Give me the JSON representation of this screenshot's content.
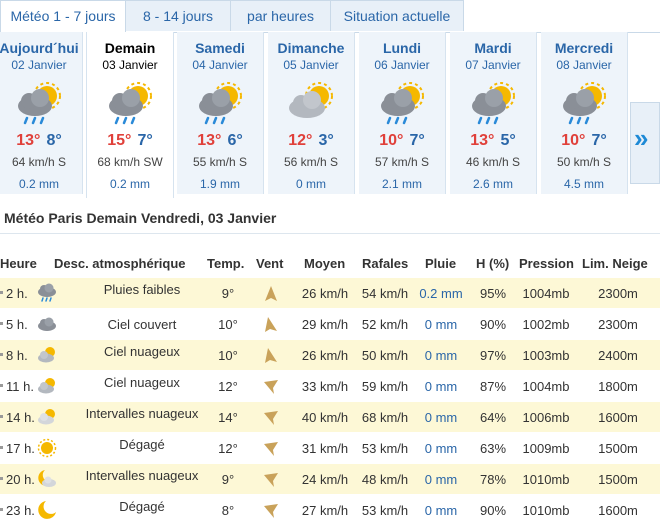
{
  "tabs": [
    {
      "label": "Météo 1 - 7 jours",
      "active": true
    },
    {
      "label": "8 - 14 jours",
      "active": false
    },
    {
      "label": "par heures",
      "active": false
    },
    {
      "label": "Situation actuelle",
      "active": false
    }
  ],
  "days": [
    {
      "name": "Aujourd´hui",
      "date": "02 Janvier",
      "tmax": "13°",
      "tmin": "8°",
      "wind": "64 km/h S",
      "rain": "0.2 mm",
      "icon": "cloud-sun-rain-icon",
      "active": false
    },
    {
      "name": "Demain",
      "date": "03 Janvier",
      "tmax": "15°",
      "tmin": "7°",
      "wind": "68 km/h SW",
      "rain": "0.2 mm",
      "icon": "cloud-sun-rain-icon",
      "active": true
    },
    {
      "name": "Samedi",
      "date": "04 Janvier",
      "tmax": "13°",
      "tmin": "6°",
      "wind": "55 km/h S",
      "rain": "1.9 mm",
      "icon": "cloud-sun-rain-icon",
      "active": false
    },
    {
      "name": "Dimanche",
      "date": "05 Janvier",
      "tmax": "12°",
      "tmin": "3°",
      "wind": "56 km/h S",
      "rain": "0 mm",
      "icon": "cloud-sun-icon",
      "active": false
    },
    {
      "name": "Lundi",
      "date": "06 Janvier",
      "tmax": "10°",
      "tmin": "7°",
      "wind": "57 km/h S",
      "rain": "2.1 mm",
      "icon": "cloud-sun-rain-icon",
      "active": false
    },
    {
      "name": "Mardi",
      "date": "07 Janvier",
      "tmax": "13°",
      "tmin": "5°",
      "wind": "46 km/h S",
      "rain": "2.6 mm",
      "icon": "cloud-sun-rain-icon",
      "active": false
    },
    {
      "name": "Mercredi",
      "date": "08 Janvier",
      "tmax": "10°",
      "tmin": "7°",
      "wind": "50 km/h S",
      "rain": "4.5 mm",
      "icon": "cloud-sun-rain-icon",
      "active": false
    }
  ],
  "next_arrow": "»",
  "title": "Météo Paris Demain Vendredi, 03 Janvier",
  "table": {
    "headers": {
      "hour": "Heure",
      "desc": "Desc. atmosphérique",
      "temp": "Temp.",
      "wind": "Vent",
      "avg": "Moyen",
      "gust": "Rafales",
      "rain": "Pluie",
      "hum": "H (%)",
      "press": "Pression",
      "snow": "Lim. Neige"
    },
    "rows": [
      {
        "hour": "2 h.",
        "icon": "cloud-rain-icon",
        "desc": "Pluies faibles",
        "temp": "9°",
        "avg": "26 km/h",
        "gust": "54 km/h",
        "rain": "0.2 mm",
        "hum": "95%",
        "press": "1004mb",
        "snow": "2300m",
        "wind_dir": "N"
      },
      {
        "hour": "5 h.",
        "icon": "cloud-icon",
        "desc": "Ciel couvert",
        "temp": "10°",
        "avg": "29 km/h",
        "gust": "52 km/h",
        "rain": "0 mm",
        "hum": "90%",
        "press": "1002mb",
        "snow": "2300m",
        "wind_dir": "NNE"
      },
      {
        "hour": "8 h.",
        "icon": "cloud-sun-icon",
        "desc": "Ciel nuageux",
        "temp": "10°",
        "avg": "26 km/h",
        "gust": "50 km/h",
        "rain": "0 mm",
        "hum": "97%",
        "press": "1003mb",
        "snow": "2400m",
        "wind_dir": "NNE"
      },
      {
        "hour": "11 h.",
        "icon": "cloud-sun-icon",
        "desc": "Ciel nuageux",
        "temp": "12°",
        "avg": "33 km/h",
        "gust": "59 km/h",
        "rain": "0 mm",
        "hum": "87%",
        "press": "1004mb",
        "snow": "1800m",
        "wind_dir": "NE"
      },
      {
        "hour": "14 h.",
        "icon": "cloud-sun-icon",
        "desc": "Intervalles nuageux",
        "temp": "14°",
        "avg": "40 km/h",
        "gust": "68 km/h",
        "rain": "0 mm",
        "hum": "64%",
        "press": "1006mb",
        "snow": "1600m",
        "wind_dir": "NE"
      },
      {
        "hour": "17 h.",
        "icon": "sun-icon",
        "desc": "Dégagé",
        "temp": "12°",
        "avg": "31 km/h",
        "gust": "53 km/h",
        "rain": "0 mm",
        "hum": "63%",
        "press": "1009mb",
        "snow": "1500m",
        "wind_dir": "NE"
      },
      {
        "hour": "20 h.",
        "icon": "moon-cloud-icon",
        "desc": "Intervalles nuageux",
        "temp": "9°",
        "avg": "24 km/h",
        "gust": "48 km/h",
        "rain": "0 mm",
        "hum": "78%",
        "press": "1010mb",
        "snow": "1500m",
        "wind_dir": "NE"
      },
      {
        "hour": "23 h.",
        "icon": "moon-icon",
        "desc": "Dégagé",
        "temp": "8°",
        "avg": "27 km/h",
        "gust": "53 km/h",
        "rain": "0 mm",
        "hum": "90%",
        "press": "1010mb",
        "snow": "1600m",
        "wind_dir": "NE"
      }
    ]
  },
  "colors": {
    "link_blue": "#2a66a8",
    "temp_max_red": "#e0403a",
    "row_highlight": "#fdf8d6",
    "wind_arrow": "#c9a25a",
    "sun": "#f5b800"
  }
}
